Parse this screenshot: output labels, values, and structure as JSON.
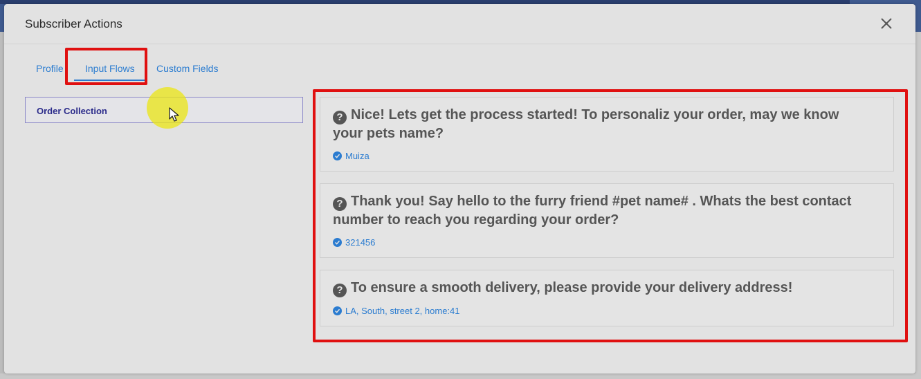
{
  "modal": {
    "title": "Subscriber Actions"
  },
  "tabs": [
    {
      "label": "Profile"
    },
    {
      "label": "Input Flows",
      "active": true
    },
    {
      "label": "Custom Fields"
    }
  ],
  "flows": [
    {
      "label": "Order Collection"
    }
  ],
  "qa": [
    {
      "question": "Nice! Lets get the process started! To personaliz your order, may we know your pets name?",
      "answer": "Muiza"
    },
    {
      "question": "Thank you! Say hello to the furry friend #pet name# . Whats the best contact number to reach you regarding your order?",
      "answer": "321456"
    },
    {
      "question": "To ensure a smooth delivery, please provide your delivery address!",
      "answer": "LA, South, street 2, home:41"
    }
  ],
  "colors": {
    "accent": "#2b7cd0",
    "highlight": "#e01010",
    "modal_bg": "#e2e2e2"
  },
  "icons": {
    "close": "close-icon",
    "question": "question-circle-icon",
    "answer": "check-circle-icon"
  }
}
